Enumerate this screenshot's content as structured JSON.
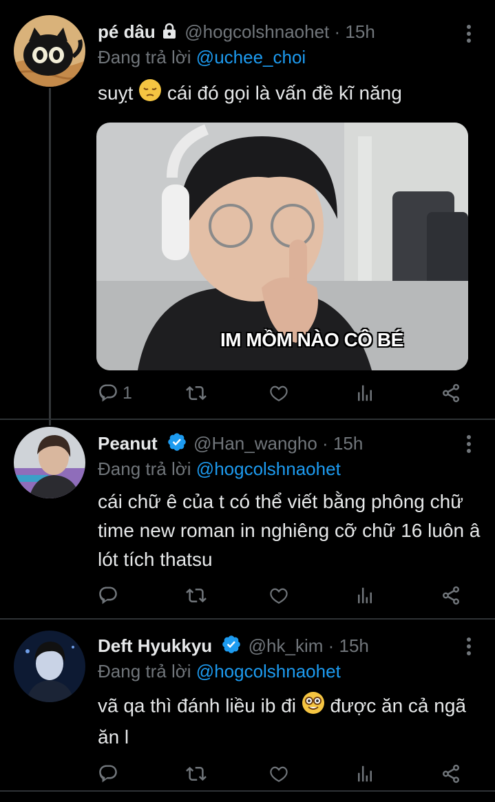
{
  "tweets": [
    {
      "name": "pé dâu",
      "handle": "@hogcolshnaohet",
      "time": "15h",
      "sep": "·",
      "reply_prefix": "Đang trả lời",
      "reply_to": "@uchee_choi",
      "text_before_emoji": "suỵt",
      "text_after_emoji": "cái đó gọi là vấn đề kĩ năng",
      "emoji": "pensive-face-emoji",
      "media_caption": "IM MỒM NÀO CÔ BÉ",
      "reply_count": "1",
      "locked": true
    },
    {
      "name": "Peanut",
      "handle": "@Han_wangho",
      "time": "15h",
      "sep": "·",
      "reply_prefix": "Đang trả lời",
      "reply_to": "@hogcolshnaohet",
      "text": "cái chữ ê của t có thể viết bằng phông chữ time new roman in nghiêng cỡ chữ 16 luôn â lót tích thatsu",
      "verified": true
    },
    {
      "name": "Deft Hyukkyu",
      "handle": "@hk_kim",
      "time": "15h",
      "sep": "·",
      "reply_prefix": "Đang trả lời",
      "reply_to": "@hogcolshnaohet",
      "text_before_emoji": "vã qa thì đánh liều ib đi",
      "text_after_emoji": "được ăn cả ngã ăn l",
      "emoji": "nerd-face-emoji",
      "verified": true
    }
  ],
  "colors": {
    "background": "#000000",
    "text": "#e7e9ea",
    "muted": "#71767b",
    "link": "#1d9bf0",
    "divider": "#2f3336"
  },
  "icons": [
    "reply-icon",
    "retweet-icon",
    "like-icon",
    "analytics-icon",
    "share-icon",
    "more-icon",
    "lock-icon",
    "verified-badge-icon"
  ]
}
